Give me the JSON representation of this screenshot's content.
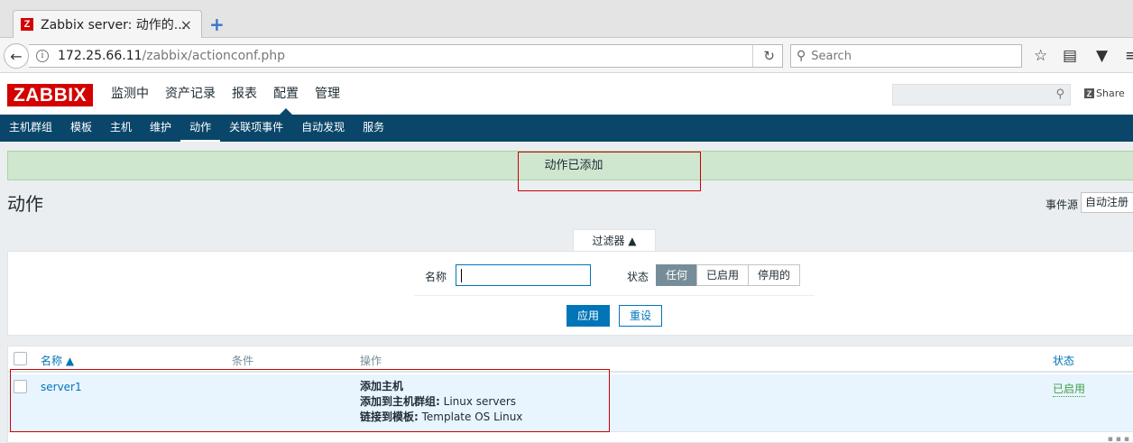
{
  "browser": {
    "tab_title": "Zabbix server: 动作的...",
    "tab_close": "×",
    "new_tab": "+",
    "url_host": "172.25.66.11",
    "url_path": "/zabbix/actionconf.php",
    "search_placeholder": "Search"
  },
  "zabbix": {
    "logo": "ZABBIX",
    "main_menu": [
      "监测中",
      "资产记录",
      "报表",
      "配置",
      "管理"
    ],
    "share_label": "Share",
    "sub_menu": [
      "主机群组",
      "模板",
      "主机",
      "维护",
      "动作",
      "关联项事件",
      "自动发现",
      "服务"
    ]
  },
  "message": "动作已添加",
  "page": {
    "title": "动作",
    "event_source_label": "事件源",
    "event_source_value": "自动注册"
  },
  "filter": {
    "tab_label": "过滤器 ▲",
    "name_label": "名称",
    "name_value": "",
    "status_label": "状态",
    "status_options": [
      "任何",
      "已启用",
      "停用的"
    ],
    "apply_label": "应用",
    "reset_label": "重设"
  },
  "table": {
    "headers": {
      "name": "名称 ▲",
      "conditions": "条件",
      "operations": "操作",
      "status": "状态"
    },
    "rows": [
      {
        "name": "server1",
        "conditions": "",
        "operations": [
          {
            "label": "添加主机",
            "value": ""
          },
          {
            "label": "添加到主机群组:",
            "value": " Linux servers"
          },
          {
            "label": "链接到模板:",
            "value": " Template OS Linux"
          }
        ],
        "status": "已启用"
      }
    ]
  },
  "colors": {
    "brand": "#d40000",
    "nav_dark": "#0a466a",
    "link": "#0275b8",
    "success_bg": "#cfe6cf",
    "status_enabled": "#429e47",
    "annotation_box": "#cc0000"
  }
}
